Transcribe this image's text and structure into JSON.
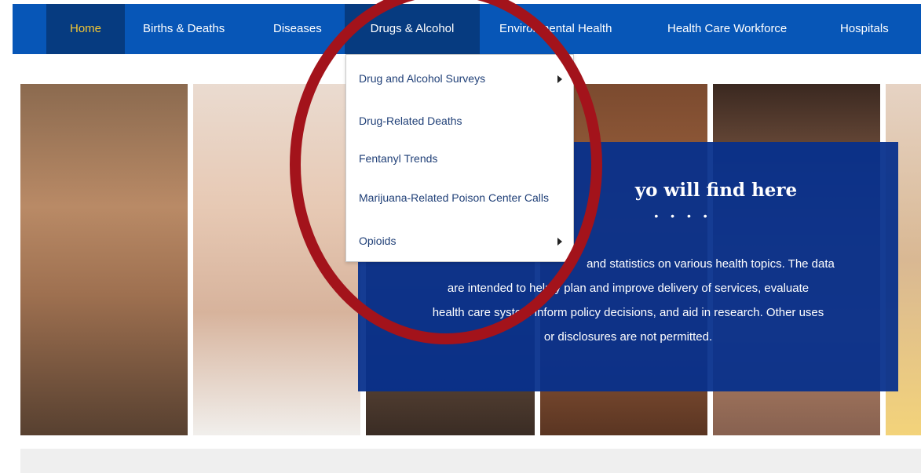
{
  "nav": {
    "items": [
      {
        "label": "Home"
      },
      {
        "label": "Births & Deaths"
      },
      {
        "label": "Diseases"
      },
      {
        "label": "Drugs & Alcohol"
      },
      {
        "label": "Environmental Health"
      },
      {
        "label": "Health Care Workforce"
      },
      {
        "label": "Hospitals"
      }
    ]
  },
  "dropdown": {
    "items": [
      {
        "label": "Drug and Alcohol Surveys",
        "has_submenu": true
      },
      {
        "label": "Drug-Related Deaths",
        "has_submenu": false
      },
      {
        "label": "Fentanyl Trends",
        "has_submenu": false
      },
      {
        "label": "Marijuana-Related Poison Center Calls",
        "has_submenu": false
      },
      {
        "label": "Opioids",
        "has_submenu": true
      }
    ]
  },
  "panel": {
    "title_visible": "yo  will find here",
    "dots": "• • • •",
    "body_lines": [
      "and statistics on various health topics. The data",
      "are intended to help y   plan and improve delivery of services, evaluate",
      "health care system    inform policy decisions, and aid in research. Other uses",
      "or disclosures are not permitted."
    ]
  },
  "colors": {
    "nav_bg": "#0756b7",
    "nav_active_bg": "#063b80",
    "home_text": "#f3c634",
    "panel_bg": "#06308c",
    "annotation": "#a3131b"
  }
}
